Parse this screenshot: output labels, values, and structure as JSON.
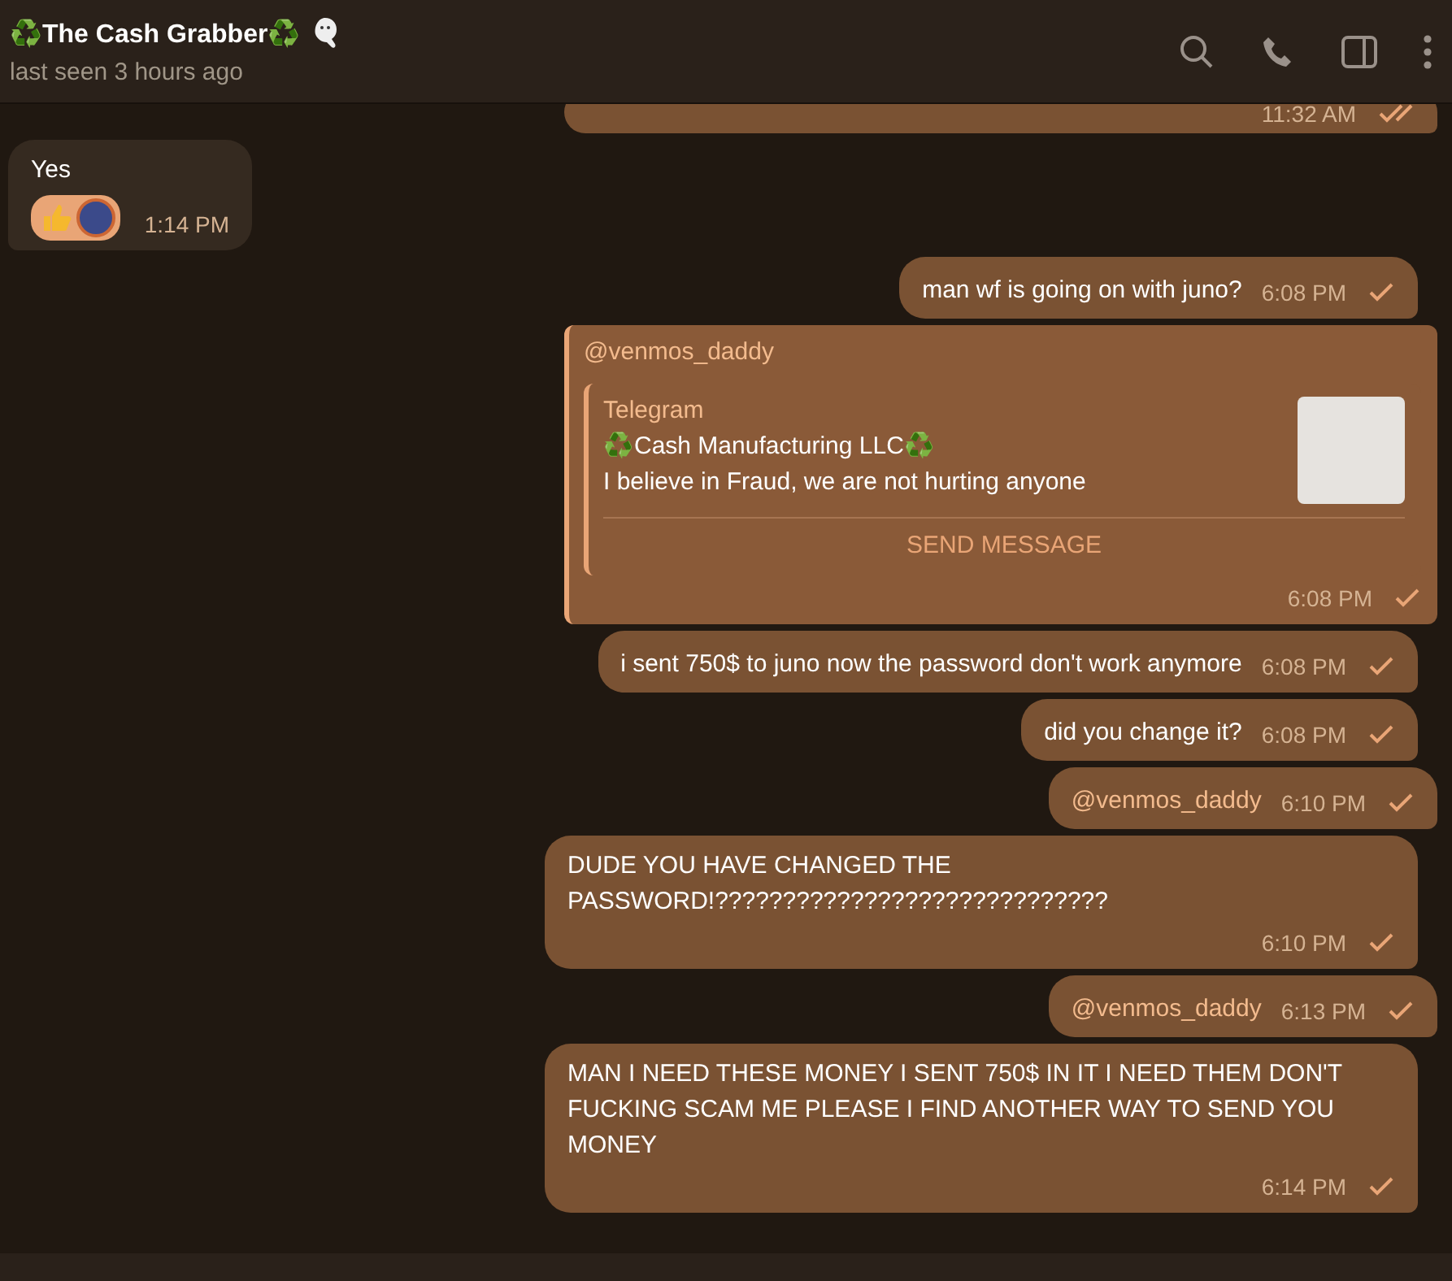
{
  "header": {
    "title": "♻️The Cash Grabber♻️",
    "status": "last seen 3 hours ago"
  },
  "messages": [
    {
      "kind": "partial",
      "outgoing": true,
      "time": "11:32 AM",
      "read": true
    },
    {
      "kind": "text",
      "outgoing": false,
      "text": "Yes",
      "time": "1:14 PM",
      "reactions": true
    },
    {
      "kind": "text",
      "outgoing": true,
      "text": "man wf is going on with juno?",
      "time": "6:08 PM",
      "read": false
    },
    {
      "kind": "preview",
      "outgoing": true,
      "mention": "@venmos_daddy",
      "site": "Telegram",
      "preview_title": "♻️Cash Manufacturing LLC♻️",
      "preview_text": "I believe in Fraud, we are not hurting anyone",
      "action": "SEND MESSAGE",
      "time": "6:08 PM",
      "read": false
    },
    {
      "kind": "text",
      "outgoing": true,
      "text": "i sent 750$ to juno now the password don't work anymore",
      "time": "6:08 PM",
      "read": false
    },
    {
      "kind": "text",
      "outgoing": true,
      "text": "did you change it?",
      "time": "6:08 PM",
      "read": false
    },
    {
      "kind": "mention",
      "outgoing": true,
      "text": "@venmos_daddy",
      "time": "6:10 PM",
      "read": false
    },
    {
      "kind": "text",
      "outgoing": true,
      "text": "DUDE YOU HAVE CHANGED  THE PASSWORD!?????????????????????????????",
      "time": "6:10 PM",
      "read": false
    },
    {
      "kind": "mention",
      "outgoing": true,
      "text": "@venmos_daddy",
      "time": "6:13 PM",
      "read": false
    },
    {
      "kind": "text",
      "outgoing": true,
      "text": "MAN I NEED THESE MONEY I SENT 750$ IN IT I NEED THEM DON'T FUCKING SCAM ME PLEASE I FIND ANOTHER WAY TO SEND YOU MONEY",
      "time": "6:14 PM",
      "read": false
    }
  ]
}
